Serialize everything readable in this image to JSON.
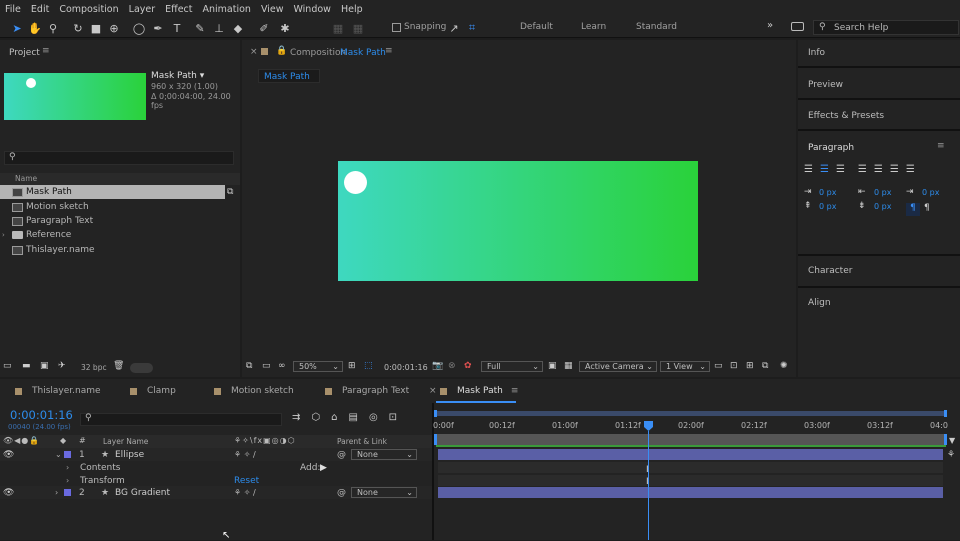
{
  "menu": [
    "File",
    "Edit",
    "Composition",
    "Layer",
    "Effect",
    "Animation",
    "View",
    "Window",
    "Help"
  ],
  "toolbar": {
    "snapping_label": "Snapping",
    "workspaces": [
      "Default",
      "Learn",
      "Standard"
    ],
    "search_placeholder": "Search Help"
  },
  "project": {
    "title": "Project",
    "comp_name": "Mask Path",
    "comp_dims": "960 x 320 (1.00)",
    "comp_duration": "Δ 0;00:04:00, 24.00 fps",
    "search_placeholder": "",
    "name_header": "Name",
    "items": [
      {
        "name": "Mask Path",
        "type": "comp"
      },
      {
        "name": "Motion sketch",
        "type": "comp"
      },
      {
        "name": "Paragraph Text",
        "type": "comp"
      },
      {
        "name": "Reference",
        "type": "folder"
      },
      {
        "name": "Thislayer.name",
        "type": "comp"
      }
    ],
    "bpc": "32 bpc"
  },
  "composition": {
    "panel_label": "Composition",
    "panel_name": "Mask Path",
    "tab": "Mask Path",
    "zoom": "50%",
    "timecode": "0:00:01:16",
    "resolution": "Full",
    "camera": "Active Camera",
    "view": "1 View",
    "gradient_start": "#3ed8c0",
    "gradient_end": "#2ad23a"
  },
  "right_panels": {
    "info": "Info",
    "preview": "Preview",
    "effects": "Effects & Presets",
    "paragraph": "Paragraph",
    "indent_values": [
      "0 px",
      "0 px",
      "0 px",
      "0 px",
      "0 px"
    ],
    "character": "Character",
    "align": "Align"
  },
  "timeline": {
    "tabs": [
      "Thislayer.name",
      "Clamp",
      "Motion sketch",
      "Paragraph Text",
      "Mask Path"
    ],
    "timecode": "0:00:01:16",
    "frame_info": "00040 (24.00 fps)",
    "layer_name_header": "Layer Name",
    "parent_header": "Parent & Link",
    "ticks": [
      "0:00f",
      "00:12f",
      "01:00f",
      "01:12f",
      "02:00f",
      "02:12f",
      "03:00f",
      "03:12f",
      "04:0"
    ],
    "layers": [
      {
        "num": "1",
        "name": "Ellipse",
        "parent": "None",
        "color": "#6a6ae0"
      },
      {
        "num": "2",
        "name": "BG Gradient",
        "parent": "None",
        "color": "#6a6ae0"
      }
    ],
    "contents_label": "Contents",
    "add_label": "Add:",
    "transform_label": "Transform",
    "reset_label": "Reset"
  }
}
